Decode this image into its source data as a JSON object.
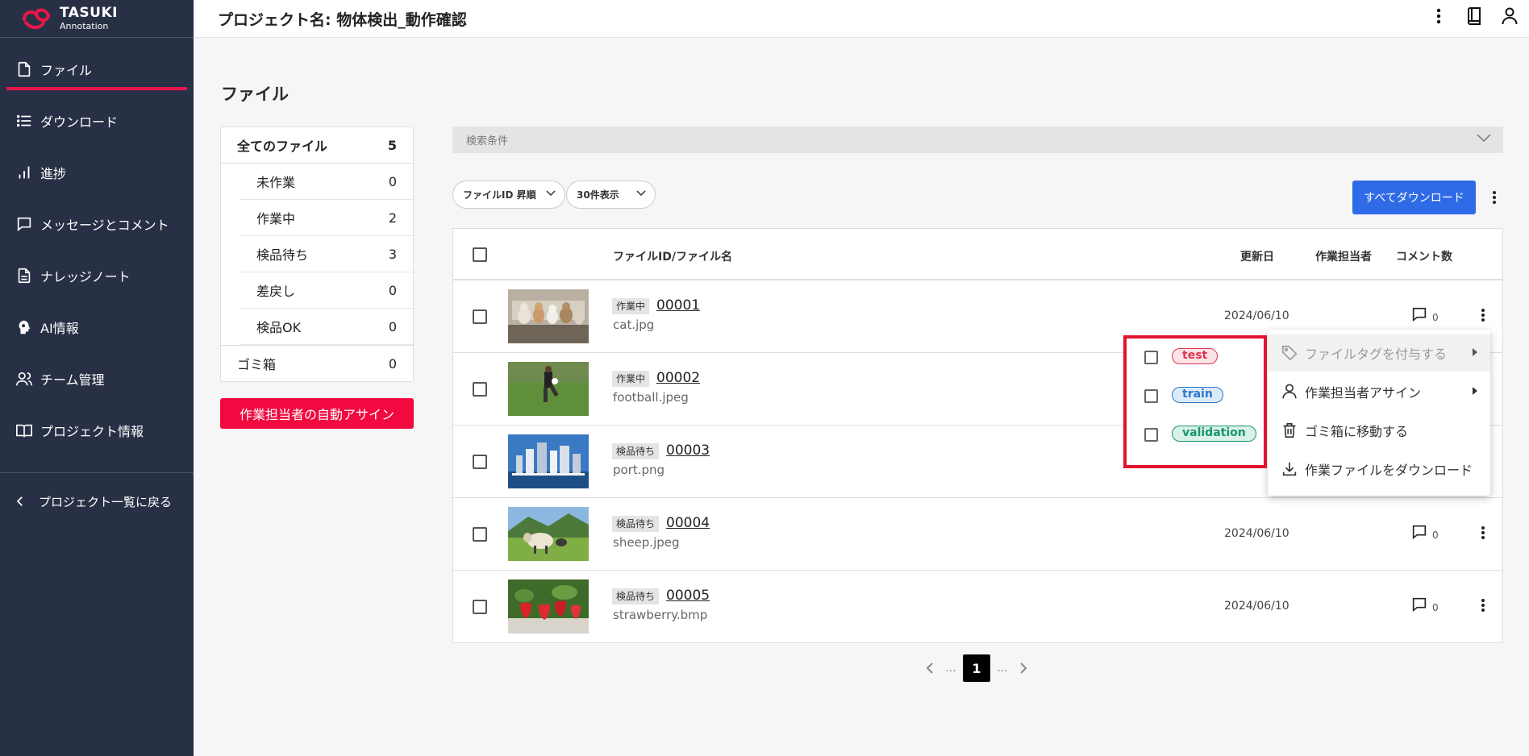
{
  "app": {
    "logo_title": "TASUKI",
    "logo_sub": "Annotation",
    "brand_color": "#e8174a"
  },
  "sidebar": {
    "items": [
      {
        "label": "ファイル",
        "icon": "file-icon"
      },
      {
        "label": "ダウンロード",
        "icon": "list-icon"
      },
      {
        "label": "進捗",
        "icon": "bar-chart-icon"
      },
      {
        "label": "メッセージとコメント",
        "icon": "chat-icon"
      },
      {
        "label": "ナレッジノート",
        "icon": "document-icon"
      },
      {
        "label": "AI情報",
        "icon": "ai-head-icon"
      },
      {
        "label": "チーム管理",
        "icon": "team-icon"
      },
      {
        "label": "プロジェクト情報",
        "icon": "book-icon"
      }
    ],
    "back_label": "プロジェクト一覧に戻る"
  },
  "header": {
    "project_title": "プロジェクト名: 物体検出_動作確認"
  },
  "page": {
    "heading": "ファイル"
  },
  "status_panel": {
    "all_label": "全てのファイル",
    "all_count": "5",
    "items": [
      {
        "label": "未作業",
        "count": "0"
      },
      {
        "label": "作業中",
        "count": "2"
      },
      {
        "label": "検品待ち",
        "count": "3"
      },
      {
        "label": "差戻し",
        "count": "0"
      },
      {
        "label": "検品OK",
        "count": "0"
      }
    ],
    "trash_label": "ゴミ箱",
    "trash_count": "0",
    "auto_assign_label": "作業担当者の自動アサイン"
  },
  "search": {
    "label": "検索条件"
  },
  "controls": {
    "sort_label": "ファイルID 昇順",
    "per_page_label": "30件表示",
    "download_all_label": "すべてダウンロード"
  },
  "table": {
    "columns": {
      "file": "ファイルID/ファイル名",
      "updated": "更新日",
      "assignee": "作業担当者",
      "comments": "コメント数"
    },
    "rows": [
      {
        "status": "作業中",
        "id": "00001",
        "name": "cat.jpg",
        "date": "2024/06/10",
        "comments": "0",
        "thumb": "cats"
      },
      {
        "status": "作業中",
        "id": "00002",
        "name": "football.jpeg",
        "date": "",
        "comments": "",
        "thumb": "football"
      },
      {
        "status": "検品待ち",
        "id": "00003",
        "name": "port.png",
        "date": "",
        "comments": "",
        "thumb": "port"
      },
      {
        "status": "検品待ち",
        "id": "00004",
        "name": "sheep.jpeg",
        "date": "2024/06/10",
        "comments": "0",
        "thumb": "sheep"
      },
      {
        "status": "検品待ち",
        "id": "00005",
        "name": "strawberry.bmp",
        "date": "2024/06/10",
        "comments": "0",
        "thumb": "strawberry"
      }
    ]
  },
  "pagination": {
    "current": "1",
    "ellipsis": "..."
  },
  "context_menu": {
    "items": [
      {
        "label": "ファイルタグを付与する",
        "icon": "tag-icon"
      },
      {
        "label": "作業担当者アサイン",
        "icon": "person-icon"
      },
      {
        "label": "ゴミ箱に移動する",
        "icon": "trash-icon"
      },
      {
        "label": "作業ファイルをダウンロード",
        "icon": "download-icon"
      }
    ]
  },
  "tag_menu": {
    "tags": [
      {
        "label": "test",
        "color": "#e0344f",
        "bg": "#fbe3e6"
      },
      {
        "label": "train",
        "color": "#2a78c9",
        "bg": "#dcebfa"
      },
      {
        "label": "validation",
        "color": "#1a9470",
        "bg": "#d9f2e8"
      }
    ]
  }
}
